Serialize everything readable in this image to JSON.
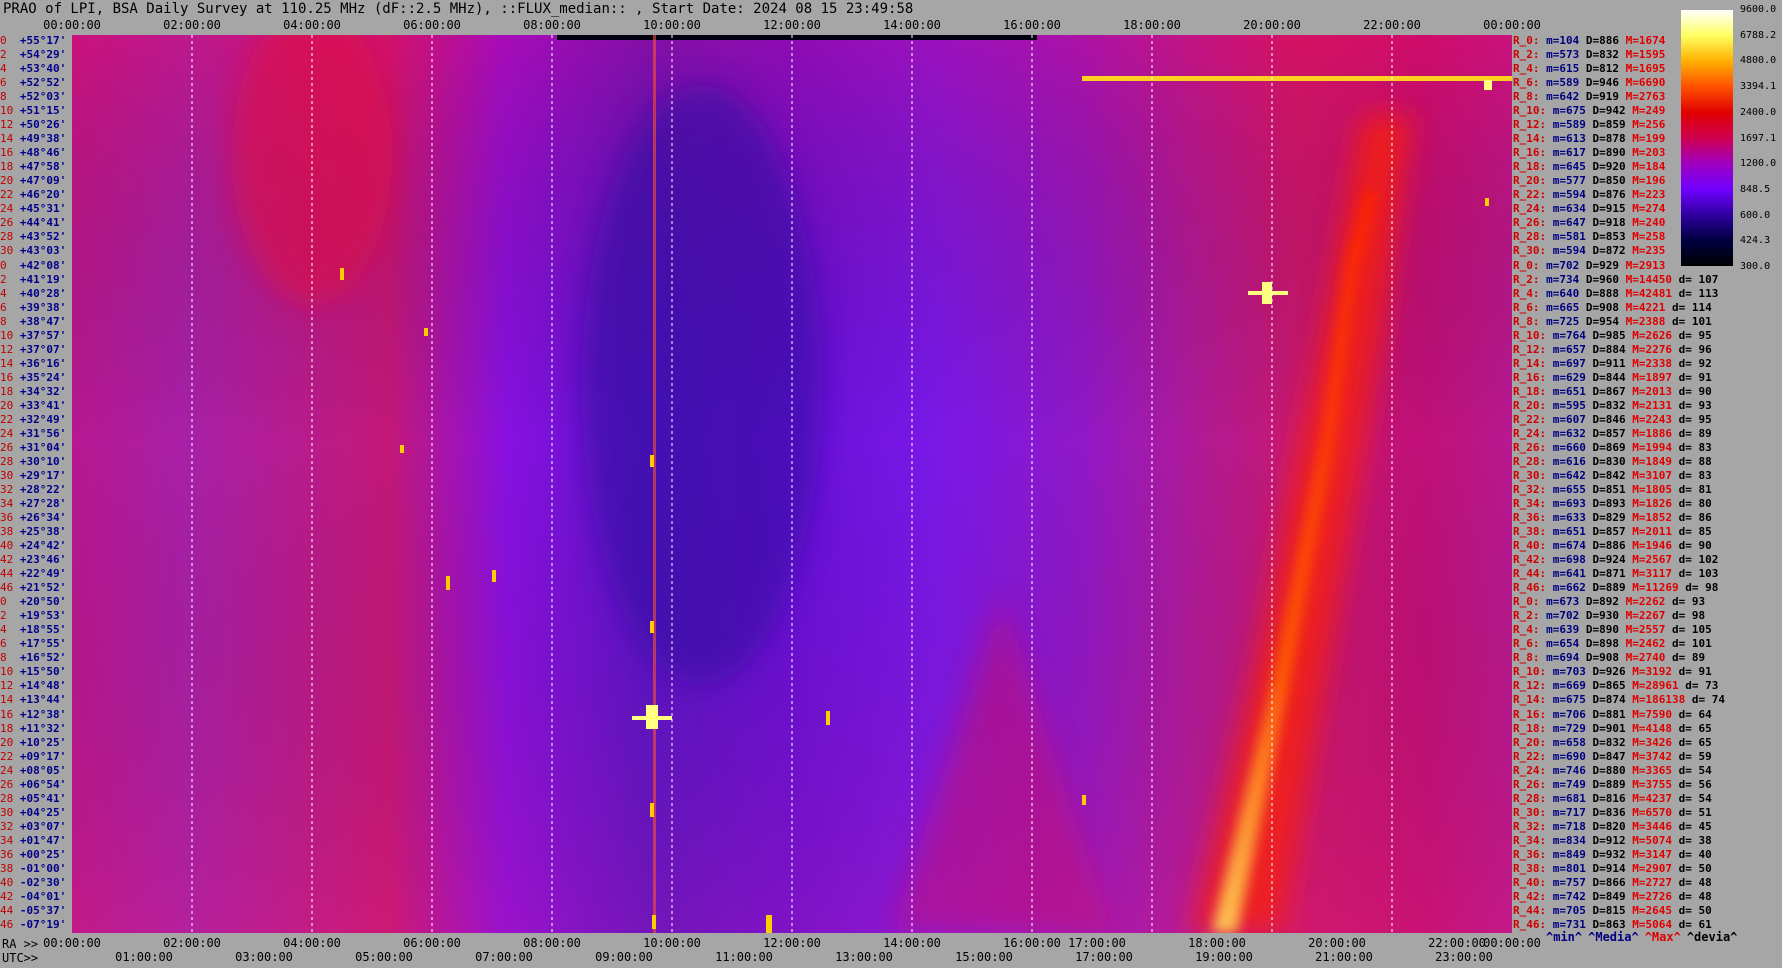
{
  "title": "PRAO of LPI, BSA Daily Survey at 110.25 MHz (dF::2.5 MHz), ::FLUX_median:: , Start Date: 2024 08 15 23:49:58",
  "colors": {
    "background": "#a6a6a6",
    "grid": "#ffffff",
    "dec_text": "#00008b",
    "index_text": "#c00000",
    "max_text": "#e00000",
    "min_text": "#000080"
  },
  "chart_data": {
    "type": "heatmap",
    "title": "PRAO of LPI, BSA Daily Survey at 110.25 MHz (dF::2.5 MHz), ::FLUX_median:: , Start Date: 2024 08 15 23:49:58",
    "x_top_ticks": [
      "00:00:00",
      "02:00:00",
      "04:00:00",
      "06:00:00",
      "08:00:00",
      "10:00:00",
      "12:00:00",
      "14:00:00",
      "16:00:00",
      "18:00:00",
      "20:00:00",
      "22:00:00",
      "00:00:00"
    ],
    "x_bottom_ra_prefix": "RA >>",
    "x_bottom_ra_ticks": [
      "00:00:00",
      "02:00:00",
      "04:00:00",
      "06:00:00",
      "08:00:00",
      "10:00:00",
      "12:00:00",
      "14:00:00",
      "16:00:00",
      "17:00:00",
      "18:00:00",
      "20:00:00",
      "22:00:00",
      "00:00:00"
    ],
    "x_bottom_utc_prefix": "UTC>>",
    "x_bottom_utc_ticks": [
      "01:00:00",
      "03:00:00",
      "05:00:00",
      "07:00:00",
      "09:00:00",
      "11:00:00",
      "13:00:00",
      "15:00:00",
      "17:00:00",
      "19:00:00",
      "21:00:00",
      "23:00:00"
    ],
    "y_rows": [
      {
        "i": "0",
        "dec": "+55°17'"
      },
      {
        "i": "2",
        "dec": "+54°29'"
      },
      {
        "i": "4",
        "dec": "+53°40'"
      },
      {
        "i": "6",
        "dec": "+52°52'"
      },
      {
        "i": "8",
        "dec": "+52°03'"
      },
      {
        "i": "10",
        "dec": "+51°15'"
      },
      {
        "i": "12",
        "dec": "+50°26'"
      },
      {
        "i": "14",
        "dec": "+49°38'"
      },
      {
        "i": "16",
        "dec": "+48°46'"
      },
      {
        "i": "18",
        "dec": "+47°58'"
      },
      {
        "i": "20",
        "dec": "+47°09'"
      },
      {
        "i": "22",
        "dec": "+46°20'"
      },
      {
        "i": "24",
        "dec": "+45°31'"
      },
      {
        "i": "26",
        "dec": "+44°41'"
      },
      {
        "i": "28",
        "dec": "+43°52'"
      },
      {
        "i": "30",
        "dec": "+43°03'"
      },
      {
        "i": "0",
        "dec": "+42°08'"
      },
      {
        "i": "2",
        "dec": "+41°19'"
      },
      {
        "i": "4",
        "dec": "+40°28'"
      },
      {
        "i": "6",
        "dec": "+39°38'"
      },
      {
        "i": "8",
        "dec": "+38°47'"
      },
      {
        "i": "10",
        "dec": "+37°57'"
      },
      {
        "i": "12",
        "dec": "+37°07'"
      },
      {
        "i": "14",
        "dec": "+36°16'"
      },
      {
        "i": "16",
        "dec": "+35°24'"
      },
      {
        "i": "18",
        "dec": "+34°32'"
      },
      {
        "i": "20",
        "dec": "+33°41'"
      },
      {
        "i": "22",
        "dec": "+32°49'"
      },
      {
        "i": "24",
        "dec": "+31°56'"
      },
      {
        "i": "26",
        "dec": "+31°04'"
      },
      {
        "i": "28",
        "dec": "+30°10'"
      },
      {
        "i": "30",
        "dec": "+29°17'"
      },
      {
        "i": "32",
        "dec": "+28°22'"
      },
      {
        "i": "34",
        "dec": "+27°28'"
      },
      {
        "i": "36",
        "dec": "+26°34'"
      },
      {
        "i": "38",
        "dec": "+25°38'"
      },
      {
        "i": "40",
        "dec": "+24°42'"
      },
      {
        "i": "42",
        "dec": "+23°46'"
      },
      {
        "i": "44",
        "dec": "+22°49'"
      },
      {
        "i": "46",
        "dec": "+21°52'"
      },
      {
        "i": "0",
        "dec": "+20°50'"
      },
      {
        "i": "2",
        "dec": "+19°53'"
      },
      {
        "i": "4",
        "dec": "+18°55'"
      },
      {
        "i": "6",
        "dec": "+17°55'"
      },
      {
        "i": "8",
        "dec": "+16°52'"
      },
      {
        "i": "10",
        "dec": "+15°50'"
      },
      {
        "i": "12",
        "dec": "+14°48'"
      },
      {
        "i": "14",
        "dec": "+13°44'"
      },
      {
        "i": "16",
        "dec": "+12°38'"
      },
      {
        "i": "18",
        "dec": "+11°32'"
      },
      {
        "i": "20",
        "dec": "+10°25'"
      },
      {
        "i": "22",
        "dec": "+09°17'"
      },
      {
        "i": "24",
        "dec": "+08°05'"
      },
      {
        "i": "26",
        "dec": "+06°54'"
      },
      {
        "i": "28",
        "dec": "+05°41'"
      },
      {
        "i": "30",
        "dec": "+04°25'"
      },
      {
        "i": "32",
        "dec": "+03°07'"
      },
      {
        "i": "34",
        "dec": "+01°47'"
      },
      {
        "i": "36",
        "dec": "+00°25'"
      },
      {
        "i": "38",
        "dec": "-01°00'"
      },
      {
        "i": "40",
        "dec": "-02°30'"
      },
      {
        "i": "42",
        "dec": "-04°01'"
      },
      {
        "i": "44",
        "dec": "-05°37'"
      },
      {
        "i": "46",
        "dec": "-07°19'"
      }
    ],
    "stats": [
      {
        "r": "R_0:",
        "m": "m=104",
        "D": "D=886",
        "M": "M=1674",
        "d": ""
      },
      {
        "r": "R_2:",
        "m": "m=573",
        "D": "D=832",
        "M": "M=1595",
        "d": ""
      },
      {
        "r": "R_4:",
        "m": "m=615",
        "D": "D=812",
        "M": "M=1695",
        "d": ""
      },
      {
        "r": "R_6:",
        "m": "m=589",
        "D": "D=946",
        "M": "M=6690",
        "d": ""
      },
      {
        "r": "R_8:",
        "m": "m=642",
        "D": "D=919",
        "M": "M=2763",
        "d": ""
      },
      {
        "r": "R_10:",
        "m": "m=675",
        "D": "D=942",
        "M": "M=249",
        "d": ""
      },
      {
        "r": "R_12:",
        "m": "m=589",
        "D": "D=859",
        "M": "M=256",
        "d": ""
      },
      {
        "r": "R_14:",
        "m": "m=613",
        "D": "D=878",
        "M": "M=199",
        "d": ""
      },
      {
        "r": "R_16:",
        "m": "m=617",
        "D": "D=890",
        "M": "M=203",
        "d": ""
      },
      {
        "r": "R_18:",
        "m": "m=645",
        "D": "D=920",
        "M": "M=184",
        "d": ""
      },
      {
        "r": "R_20:",
        "m": "m=577",
        "D": "D=850",
        "M": "M=196",
        "d": ""
      },
      {
        "r": "R_22:",
        "m": "m=594",
        "D": "D=876",
        "M": "M=223",
        "d": ""
      },
      {
        "r": "R_24:",
        "m": "m=634",
        "D": "D=915",
        "M": "M=274",
        "d": ""
      },
      {
        "r": "R_26:",
        "m": "m=647",
        "D": "D=918",
        "M": "M=240",
        "d": ""
      },
      {
        "r": "R_28:",
        "m": "m=581",
        "D": "D=853",
        "M": "M=258",
        "d": ""
      },
      {
        "r": "R_30:",
        "m": "m=594",
        "D": "D=872",
        "M": "M=235",
        "d": ""
      },
      {
        "r": "R_0:",
        "m": "m=702",
        "D": "D=929",
        "M": "M=2913",
        "d": ""
      },
      {
        "r": "R_2:",
        "m": "m=734",
        "D": "D=960",
        "M": "M=14450",
        "d": "d= 107"
      },
      {
        "r": "R_4:",
        "m": "m=640",
        "D": "D=888",
        "M": "M=42481",
        "d": "d= 113"
      },
      {
        "r": "R_6:",
        "m": "m=665",
        "D": "D=908",
        "M": "M=4221",
        "d": "d= 114"
      },
      {
        "r": "R_8:",
        "m": "m=725",
        "D": "D=954",
        "M": "M=2388",
        "d": "d= 101"
      },
      {
        "r": "R_10:",
        "m": "m=764",
        "D": "D=985",
        "M": "M=2626",
        "d": "d= 95"
      },
      {
        "r": "R_12:",
        "m": "m=657",
        "D": "D=884",
        "M": "M=2276",
        "d": "d= 96"
      },
      {
        "r": "R_14:",
        "m": "m=697",
        "D": "D=911",
        "M": "M=2338",
        "d": "d= 92"
      },
      {
        "r": "R_16:",
        "m": "m=629",
        "D": "D=844",
        "M": "M=1897",
        "d": "d= 91"
      },
      {
        "r": "R_18:",
        "m": "m=651",
        "D": "D=867",
        "M": "M=2013",
        "d": "d= 90"
      },
      {
        "r": "R_20:",
        "m": "m=595",
        "D": "D=832",
        "M": "M=2131",
        "d": "d= 93"
      },
      {
        "r": "R_22:",
        "m": "m=607",
        "D": "D=846",
        "M": "M=2243",
        "d": "d= 95"
      },
      {
        "r": "R_24:",
        "m": "m=632",
        "D": "D=857",
        "M": "M=1886",
        "d": "d= 89"
      },
      {
        "r": "R_26:",
        "m": "m=660",
        "D": "D=869",
        "M": "M=1994",
        "d": "d= 83"
      },
      {
        "r": "R_28:",
        "m": "m=616",
        "D": "D=830",
        "M": "M=1849",
        "d": "d= 88"
      },
      {
        "r": "R_30:",
        "m": "m=642",
        "D": "D=842",
        "M": "M=3107",
        "d": "d= 83"
      },
      {
        "r": "R_32:",
        "m": "m=655",
        "D": "D=851",
        "M": "M=1805",
        "d": "d= 81"
      },
      {
        "r": "R_34:",
        "m": "m=693",
        "D": "D=893",
        "M": "M=1826",
        "d": "d= 80"
      },
      {
        "r": "R_36:",
        "m": "m=633",
        "D": "D=829",
        "M": "M=1852",
        "d": "d= 86"
      },
      {
        "r": "R_38:",
        "m": "m=651",
        "D": "D=857",
        "M": "M=2011",
        "d": "d= 85"
      },
      {
        "r": "R_40:",
        "m": "m=674",
        "D": "D=886",
        "M": "M=1946",
        "d": "d= 90"
      },
      {
        "r": "R_42:",
        "m": "m=698",
        "D": "D=924",
        "M": "M=2567",
        "d": "d= 102"
      },
      {
        "r": "R_44:",
        "m": "m=641",
        "D": "D=871",
        "M": "M=3117",
        "d": "d= 103"
      },
      {
        "r": "R_46:",
        "m": "m=662",
        "D": "D=889",
        "M": "M=11269",
        "d": "d= 98"
      },
      {
        "r": "R_0:",
        "m": "m=673",
        "D": "D=892",
        "M": "M=2262",
        "d": "d= 93"
      },
      {
        "r": "R_2:",
        "m": "m=702",
        "D": "D=930",
        "M": "M=2267",
        "d": "d= 98"
      },
      {
        "r": "R_4:",
        "m": "m=639",
        "D": "D=890",
        "M": "M=2557",
        "d": "d= 105"
      },
      {
        "r": "R_6:",
        "m": "m=654",
        "D": "D=898",
        "M": "M=2462",
        "d": "d= 101"
      },
      {
        "r": "R_8:",
        "m": "m=694",
        "D": "D=908",
        "M": "M=2740",
        "d": "d= 89"
      },
      {
        "r": "R_10:",
        "m": "m=703",
        "D": "D=926",
        "M": "M=3192",
        "d": "d= 91"
      },
      {
        "r": "R_12:",
        "m": "m=669",
        "D": "D=865",
        "M": "M=28961",
        "d": "d= 73"
      },
      {
        "r": "R_14:",
        "m": "m=675",
        "D": "D=874",
        "M": "M=186138",
        "d": "d= 74"
      },
      {
        "r": "R_16:",
        "m": "m=706",
        "D": "D=881",
        "M": "M=7590",
        "d": "d= 64"
      },
      {
        "r": "R_18:",
        "m": "m=729",
        "D": "D=901",
        "M": "M=4148",
        "d": "d= 65"
      },
      {
        "r": "R_20:",
        "m": "m=658",
        "D": "D=832",
        "M": "M=3426",
        "d": "d= 65"
      },
      {
        "r": "R_22:",
        "m": "m=690",
        "D": "D=847",
        "M": "M=3742",
        "d": "d= 59"
      },
      {
        "r": "R_24:",
        "m": "m=746",
        "D": "D=880",
        "M": "M=3365",
        "d": "d= 54"
      },
      {
        "r": "R_26:",
        "m": "m=749",
        "D": "D=889",
        "M": "M=3755",
        "d": "d= 56"
      },
      {
        "r": "R_28:",
        "m": "m=681",
        "D": "D=816",
        "M": "M=4237",
        "d": "d= 54"
      },
      {
        "r": "R_30:",
        "m": "m=717",
        "D": "D=836",
        "M": "M=6570",
        "d": "d= 51"
      },
      {
        "r": "R_32:",
        "m": "m=718",
        "D": "D=820",
        "M": "M=3446",
        "d": "d= 45"
      },
      {
        "r": "R_34:",
        "m": "m=834",
        "D": "D=912",
        "M": "M=5074",
        "d": "d= 38"
      },
      {
        "r": "R_36:",
        "m": "m=849",
        "D": "D=932",
        "M": "M=3147",
        "d": "d= 40"
      },
      {
        "r": "R_38:",
        "m": "m=801",
        "D": "D=914",
        "M": "M=2907",
        "d": "d= 50"
      },
      {
        "r": "R_40:",
        "m": "m=757",
        "D": "D=866",
        "M": "M=2727",
        "d": "d= 48"
      },
      {
        "r": "R_42:",
        "m": "m=742",
        "D": "D=849",
        "M": "M=2726",
        "d": "d= 48"
      },
      {
        "r": "R_44:",
        "m": "m=705",
        "D": "D=815",
        "M": "M=2645",
        "d": "d= 50"
      },
      {
        "r": "R_46:",
        "m": "m=731",
        "D": "D=863",
        "M": "M=5064",
        "d": "d= 61"
      }
    ],
    "colorbar_labels": [
      "9600.0",
      "6788.2",
      "4800.0",
      "3394.1",
      "2400.0",
      "1697.1",
      "1200.0",
      "848.5",
      "600.0",
      "424.3",
      "300.0"
    ],
    "colorbar_colors": [
      "#ffffff",
      "#ffff60",
      "#ffb000",
      "#ff5000",
      "#e00000",
      "#d00050",
      "#a000c0",
      "#7000ff",
      "#3000a0",
      "#000040",
      "#000000"
    ],
    "legend": [
      {
        "text": "^min^",
        "color": "#000080"
      },
      {
        "text": "^Media^",
        "color": "#000080"
      },
      {
        "text": "^Max^",
        "color": "#e00000"
      },
      {
        "text": "^devia^",
        "color": "#000000"
      }
    ]
  }
}
